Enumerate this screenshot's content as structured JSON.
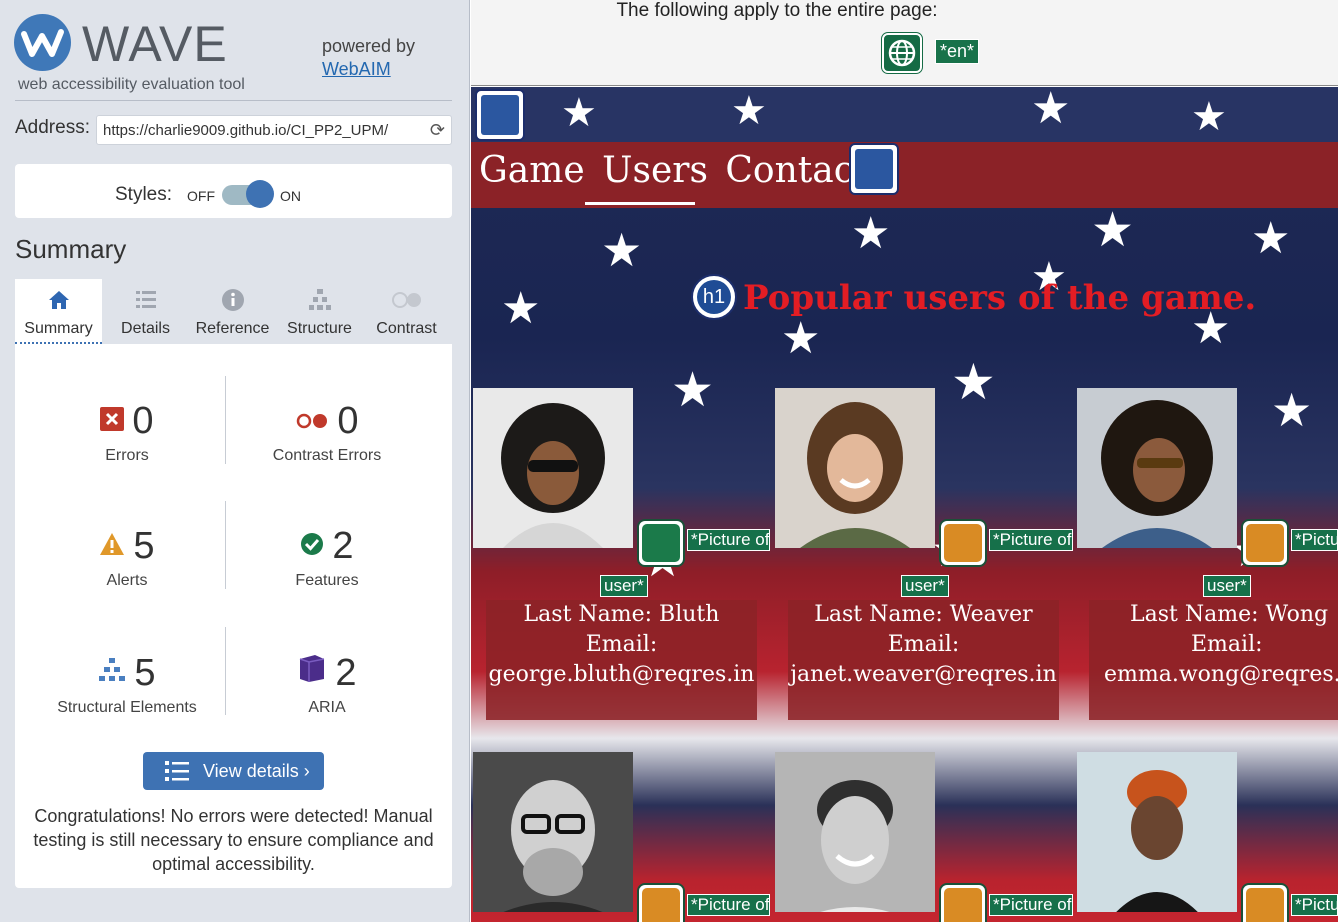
{
  "wave": {
    "title": "WAVE",
    "tagline": "web accessibility evaluation tool",
    "powered_by": "powered by",
    "webaim_link": "WebAIM",
    "address_label": "Address:",
    "address_value": "https://charlie9009.github.io/CI_PP2_UPM/",
    "styles_label": "Styles:",
    "styles_off": "OFF",
    "styles_on": "ON",
    "styles_enabled": true,
    "summary_heading": "Summary",
    "tabs": [
      {
        "label": "Summary",
        "icon": "home-icon"
      },
      {
        "label": "Details",
        "icon": "list-icon"
      },
      {
        "label": "Reference",
        "icon": "info-icon"
      },
      {
        "label": "Structure",
        "icon": "hierarchy-icon"
      },
      {
        "label": "Contrast",
        "icon": "contrast-icon"
      }
    ],
    "active_tab": "Summary",
    "stats": {
      "errors": {
        "count": "0",
        "label": "Errors"
      },
      "contrast_errors": {
        "count": "0",
        "label": "Contrast Errors"
      },
      "alerts": {
        "count": "5",
        "label": "Alerts"
      },
      "features": {
        "count": "2",
        "label": "Features"
      },
      "structural": {
        "count": "5",
        "label": "Structural Elements"
      },
      "aria": {
        "count": "2",
        "label": "ARIA"
      }
    },
    "view_details": "View details ›",
    "congrats": "Congratulations! No errors were detected! Manual testing is still necessary to ensure compliance and optimal accessibility."
  },
  "page": {
    "applies_text": "The following apply to the entire page:",
    "lang_tag": "*en*",
    "nav": [
      "Game",
      "Users",
      "Contact"
    ],
    "heading_tag": "h1",
    "heading": "Popular users of the game.",
    "alt_prefix": "*Picture of",
    "alt_prefix_cut": "*Pictu",
    "alt_suffix": "user*",
    "users": [
      {
        "last_name": "Last Name: Bluth",
        "email_label": "Email:",
        "email": "george.bluth@reqres.in"
      },
      {
        "last_name": "Last Name: Weaver",
        "email_label": "Email:",
        "email": "janet.weaver@reqres.in"
      },
      {
        "last_name": "Last Name: Wong",
        "email_label": "Email:",
        "email": "emma.wong@reqres.in"
      }
    ]
  },
  "colors": {
    "wave_blue": "#3e72b3",
    "error_red": "#c0392b",
    "feature_green": "#1b7a4a",
    "alert_orange": "#d98b24",
    "aria_purple": "#4b2d8a",
    "nav_bar": "#8b2227",
    "heading_red": "#e31d24"
  }
}
